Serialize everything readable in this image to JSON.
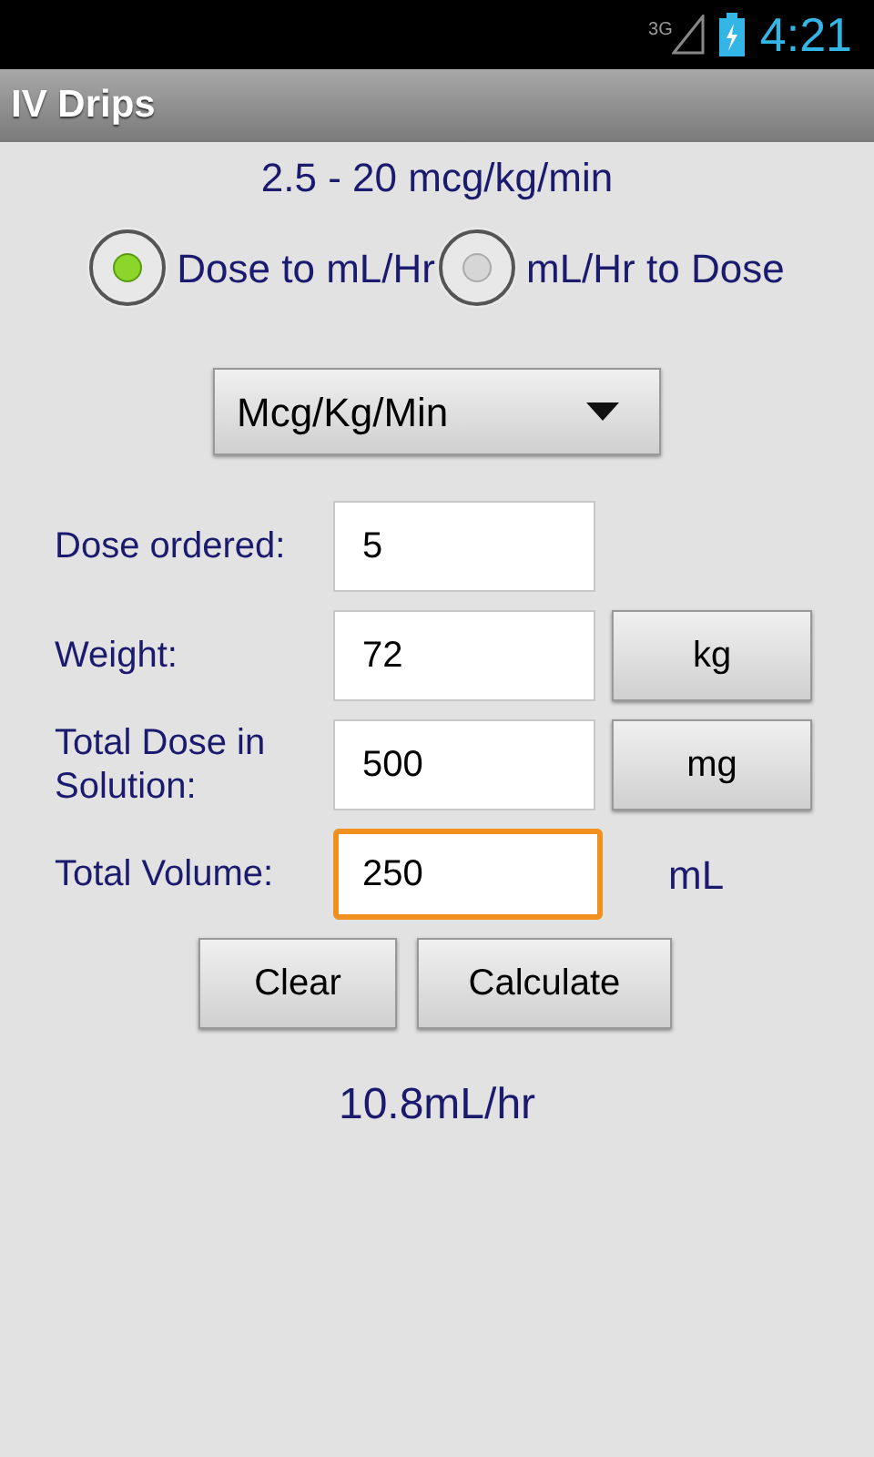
{
  "status_bar": {
    "network": "3G",
    "time": "4:21"
  },
  "title": "IV Drips",
  "range": "2.5 - 20 mcg/kg/min",
  "modes": [
    {
      "label": "Dose to mL/Hr",
      "selected": true
    },
    {
      "label": "mL/Hr to Dose",
      "selected": false
    }
  ],
  "units_dropdown": {
    "value": "Mcg/Kg/Min"
  },
  "fields": [
    {
      "label": "Dose ordered:",
      "value": "5",
      "focused": false
    },
    {
      "label": "Weight:",
      "value": "72",
      "focused": false,
      "unit": {
        "kind": "button",
        "text": "kg"
      }
    },
    {
      "label": "Total Dose in Solution:",
      "value": "500",
      "focused": false,
      "unit": {
        "kind": "button",
        "text": "mg"
      }
    },
    {
      "label": "Total Volume:",
      "value": "250",
      "focused": true,
      "unit": {
        "kind": "text",
        "text": "mL"
      }
    }
  ],
  "buttons": [
    "Clear",
    "Calculate"
  ],
  "result": "10.8mL/hr"
}
